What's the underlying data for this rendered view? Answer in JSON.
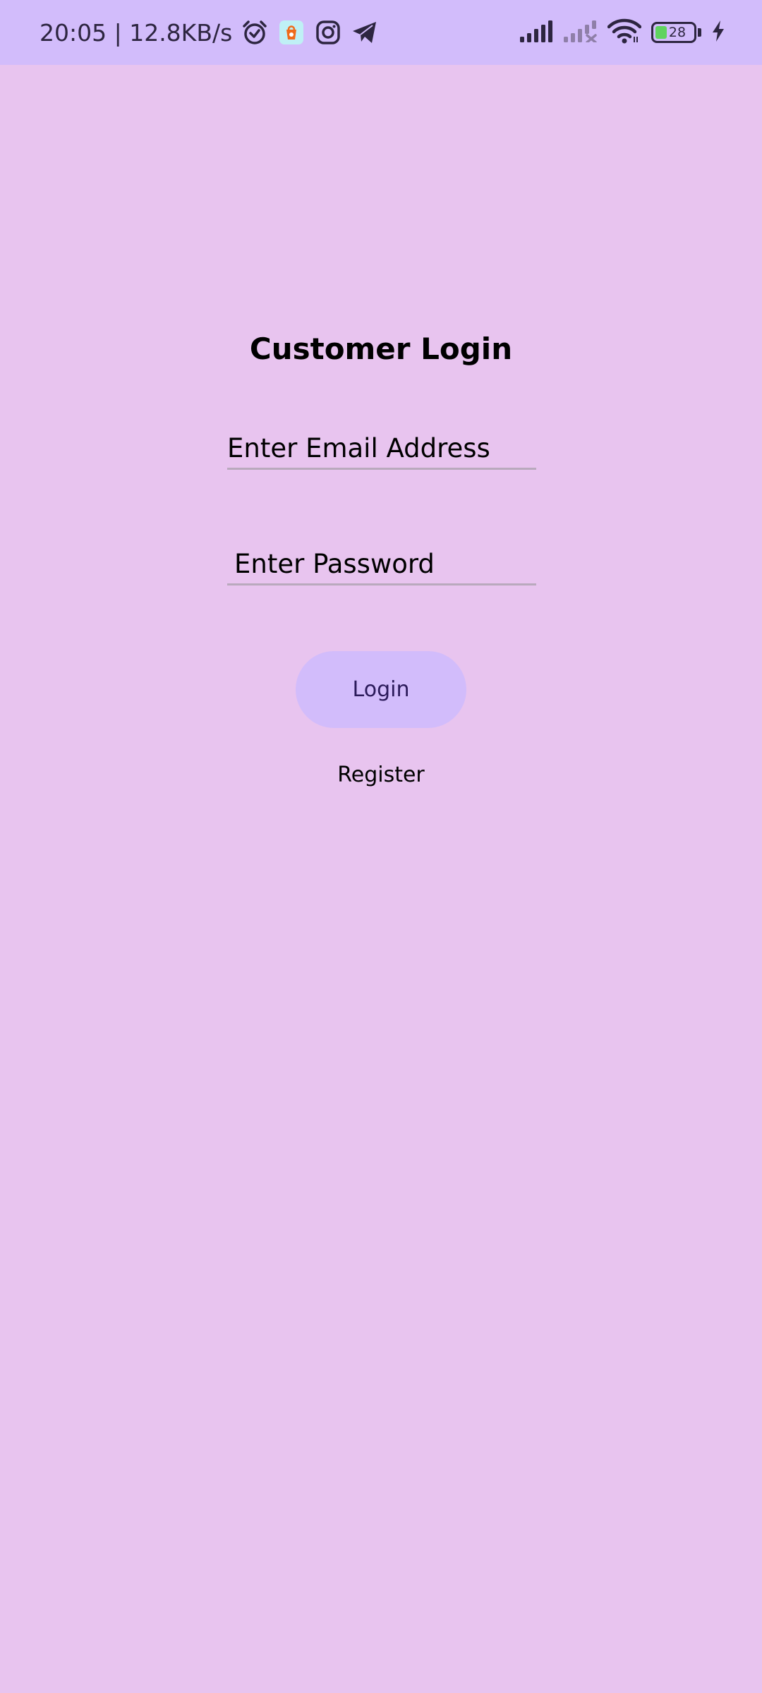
{
  "status_bar": {
    "time_speed": "20:05 | 12.8KB/s",
    "icons": [
      "alarm-icon",
      "shopping-app-icon",
      "instagram-icon",
      "telegram-icon",
      "signal-icon",
      "signal-no-service-icon",
      "wifi-icon",
      "battery-icon",
      "charging-icon"
    ],
    "battery_level": "28",
    "battery_fraction": 0.28,
    "colors": {
      "bar_bg": "#d2bcfb",
      "icon": "#2d2540",
      "battery_fill": "#5fd35f",
      "shop_icon_bg": "#bff0f5",
      "shop_icon_fg": "#f06a1a"
    }
  },
  "login": {
    "title": "Customer Login",
    "email_placeholder": "Enter Email Address",
    "email_value": "",
    "password_placeholder": "Enter Password",
    "password_value": "",
    "login_button": "Login",
    "register_link": "Register"
  },
  "colors": {
    "page_bg": "#e8c4ef",
    "button_bg": "#d2bcfb",
    "underline": "#b9a9bd",
    "button_text": "#2b1a5a"
  }
}
